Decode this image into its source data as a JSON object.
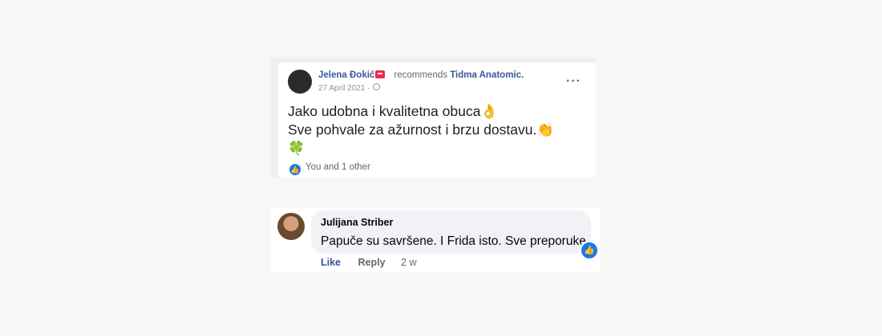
{
  "post": {
    "author": "Jelena Đokić",
    "recommends": "recommends",
    "page_name": "Tidma Anatomic.",
    "date": "27 April 2021 ·",
    "line1": "Jako udobna i kvalitetna obuca👌",
    "line2": "Sve pohvale za ažurnost i brzu dostavu.👏",
    "line3": "🍀",
    "reactions_text": "You and 1 other"
  },
  "comment": {
    "author": "Julijana Striber",
    "text": "Papuče su savršene. I Frida isto. Sve preporuke.",
    "like": "Like",
    "reply": "Reply",
    "time": "2 w"
  },
  "colors": {
    "link": "#385898",
    "like_blue": "#1877f2",
    "bubble": "#f0f2f5"
  }
}
